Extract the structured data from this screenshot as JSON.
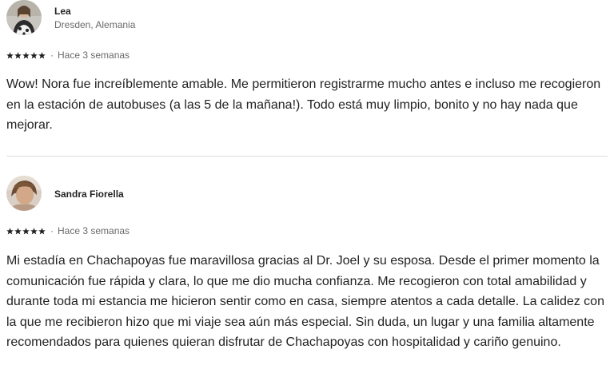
{
  "reviews": [
    {
      "name": "Lea",
      "location": "Dresden, Alemania",
      "rating": 5,
      "time": "Hace 3 semanas",
      "text": "Wow! Nora fue increíblemente amable. Me permitieron registrarme mucho antes e incluso me recogieron en la estación de autobuses (a las 5 de la mañana!). Todo está muy limpio, bonito y no hay nada que mejorar."
    },
    {
      "name": "Sandra Fiorella",
      "rating": 5,
      "time": "Hace 3 semanas",
      "text": "Mi estadía en Chachapoyas fue maravillosa gracias al Dr. Joel y su esposa. Desde el primer momento la comunicación fue rápida y clara, lo que me dio mucha confianza. Me recogieron con total amabilidad y durante toda mi estancia me hicieron sentir como en casa, siempre atentos a cada detalle. La calidez con la que me recibieron hizo que mi viaje sea aún más especial. Sin duda, un lugar y una familia altamente recomendados para quienes quieran disfrutar de Chachapoyas con hospitalidad y cariño genuino."
    }
  ],
  "separator": "·",
  "colors": {
    "text": "#222222",
    "secondary": "#6a6a6a",
    "divider": "#dddddd"
  }
}
